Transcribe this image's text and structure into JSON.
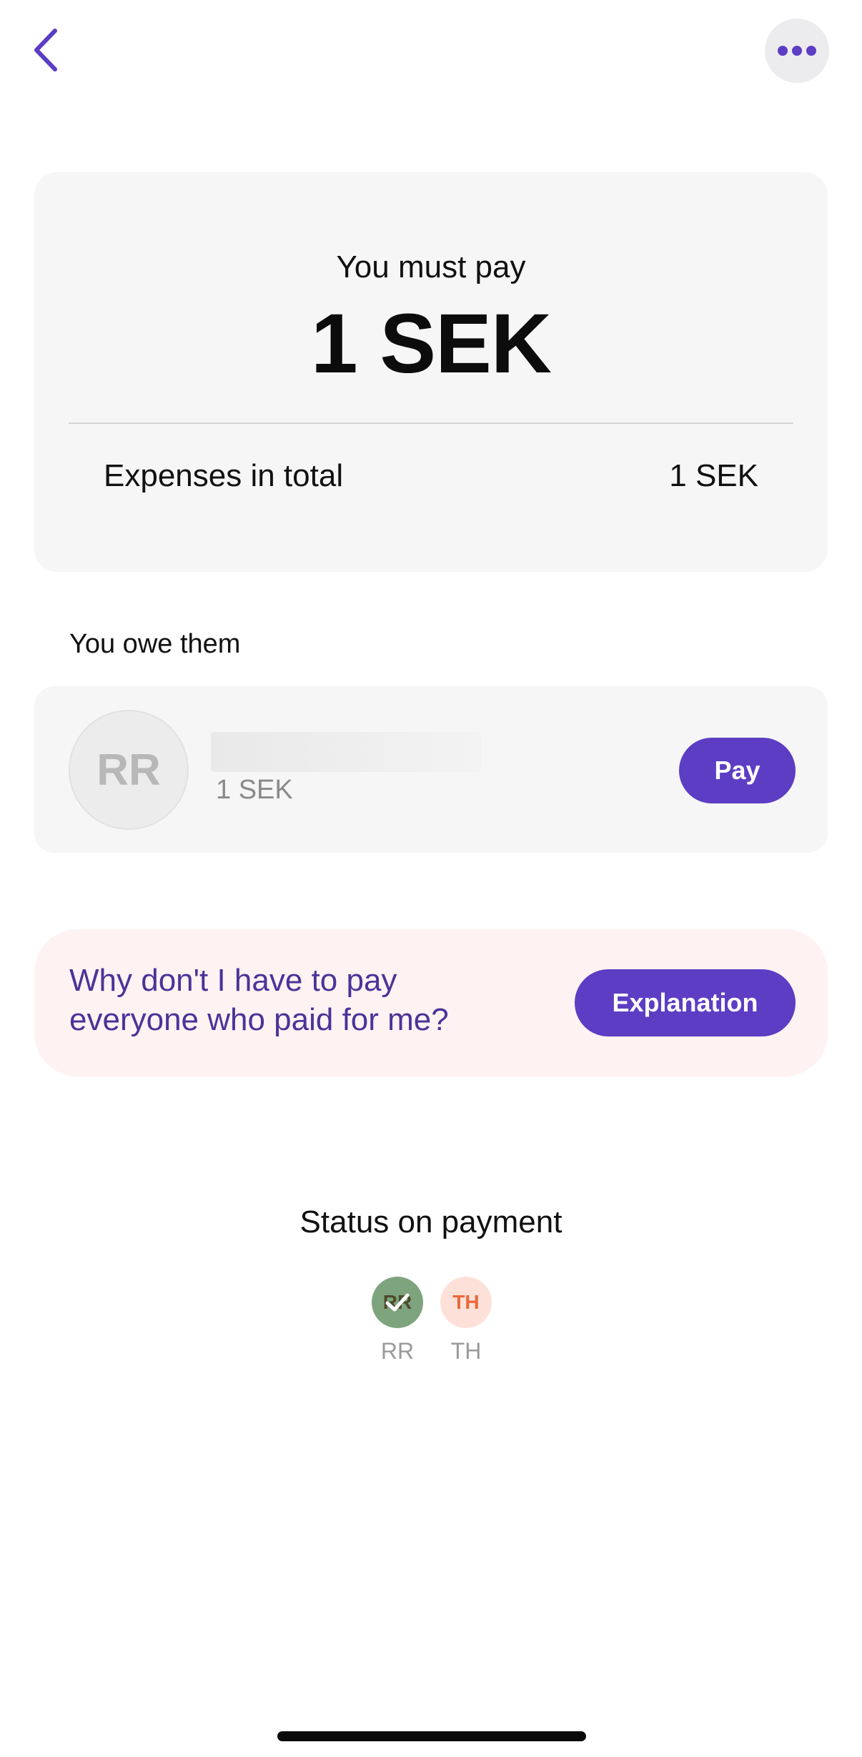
{
  "header": {
    "back_icon": "chevron-left-icon",
    "more_icon": "more-horizontal-icon",
    "accent_color": "#5c3dc4"
  },
  "summary": {
    "title": "You must pay",
    "amount": "1 SEK",
    "total_label": "Expenses in total",
    "total_value": "1 SEK"
  },
  "owe": {
    "section_title": "You owe them",
    "person": {
      "initials": "RR",
      "amount": "1 SEK",
      "pay_label": "Pay"
    }
  },
  "explanation": {
    "question": "Why don't I have to pay everyone who paid for me?",
    "button_label": "Explanation",
    "background_color": "#fff2f2"
  },
  "status": {
    "title": "Status on payment",
    "participants": [
      {
        "initials": "RR",
        "label": "RR",
        "state": "paid",
        "color": "#7ea47e"
      },
      {
        "initials": "TH",
        "label": "TH",
        "state": "pending",
        "color": "#fde1d9"
      }
    ]
  }
}
